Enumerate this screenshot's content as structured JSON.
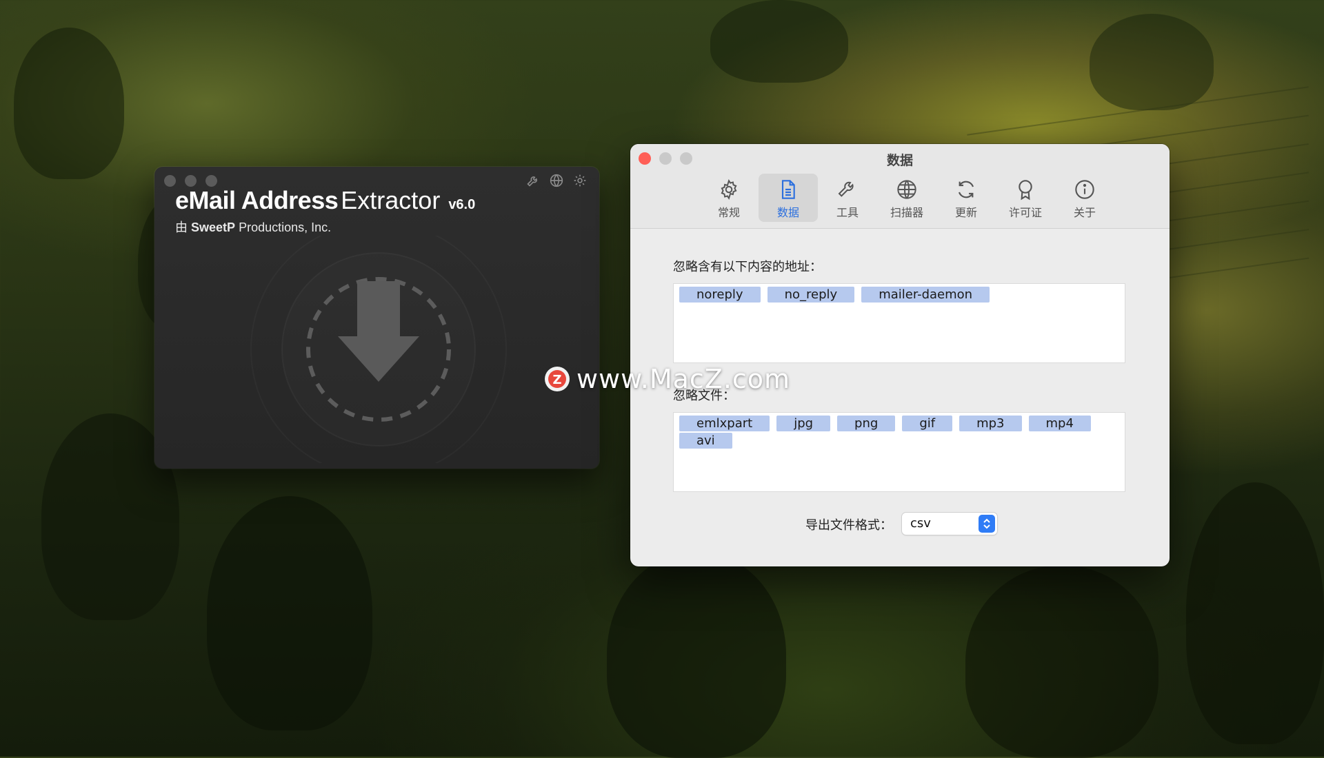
{
  "app_window": {
    "title_bold": "eMail Address",
    "title_light": "Extractor",
    "version": "v6.0",
    "subtitle_prefix": "由",
    "subtitle_company_bold": "SweetP",
    "subtitle_company_rest": "Productions, Inc.",
    "toolbar_icons": [
      "wrench-icon",
      "globe-icon",
      "gear-icon"
    ],
    "drop_icon": "download-arrow-icon"
  },
  "pref_window": {
    "title": "数据",
    "traffic_colors": {
      "close": "#ff5f57",
      "minimize": "#c9c9c9",
      "zoom": "#c9c9c9"
    },
    "accent_color": "#2b6fde",
    "tabs": [
      {
        "label": "常规",
        "icon": "gear-icon",
        "active": false
      },
      {
        "label": "数据",
        "icon": "document-icon",
        "active": true
      },
      {
        "label": "工具",
        "icon": "wrench-icon",
        "active": false
      },
      {
        "label": "扫描器",
        "icon": "globe-icon",
        "active": false
      },
      {
        "label": "更新",
        "icon": "refresh-icon",
        "active": false
      },
      {
        "label": "许可证",
        "icon": "ribbon-icon",
        "active": false
      },
      {
        "label": "关于",
        "icon": "info-icon",
        "active": false
      }
    ],
    "ignore_addresses": {
      "label": "忽略含有以下内容的地址：",
      "tokens": [
        "noreply",
        "no_reply",
        "mailer-daemon"
      ]
    },
    "ignore_files": {
      "label": "忽略文件：",
      "tokens": [
        "emlxpart",
        "jpg",
        "png",
        "gif",
        "mp3",
        "mp4",
        "avi"
      ]
    },
    "export": {
      "label": "导出文件格式：",
      "value": "csv"
    }
  },
  "watermark": {
    "text": "www.MacZ.com",
    "logo_letter": "Z"
  }
}
